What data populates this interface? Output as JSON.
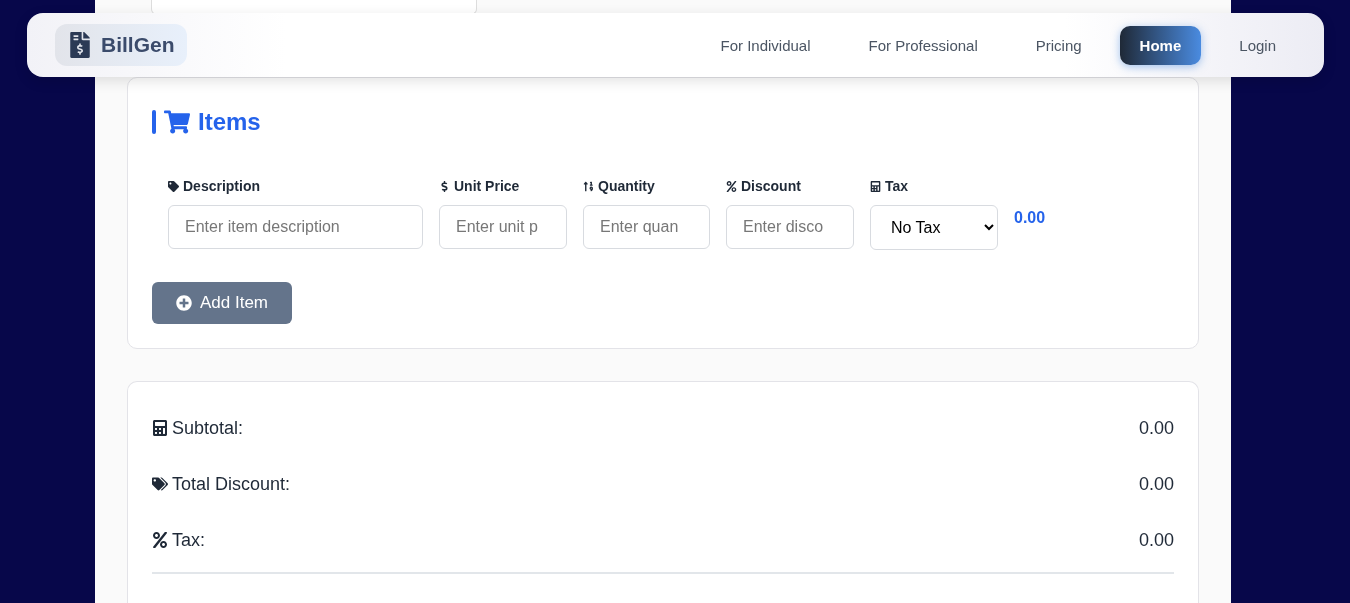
{
  "nav": {
    "brand": "BillGen",
    "links": [
      {
        "label": "For Individual",
        "selected": false
      },
      {
        "label": "For Professional",
        "selected": false
      },
      {
        "label": "Pricing",
        "selected": false
      },
      {
        "label": "Home",
        "selected": true
      },
      {
        "label": "Login",
        "selected": false
      }
    ]
  },
  "items": {
    "title": "Items",
    "fields": [
      {
        "kind": "text",
        "label": "Description",
        "placeholder": "Enter item description"
      },
      {
        "kind": "text",
        "label": "Unit Price",
        "placeholder": "Enter unit p"
      },
      {
        "kind": "text",
        "label": "Quantity",
        "placeholder": "Enter quan"
      },
      {
        "kind": "text",
        "label": "Discount",
        "placeholder": "Enter disco"
      },
      {
        "kind": "select",
        "label": "Tax",
        "value": "No Tax"
      }
    ],
    "line_total": "0.00",
    "add_button": "Add Item"
  },
  "totals": [
    {
      "label": "Subtotal:",
      "value": "0.00"
    },
    {
      "label": "Total Discount:",
      "value": "0.00"
    },
    {
      "label": "Tax:",
      "value": "0.00"
    }
  ]
}
